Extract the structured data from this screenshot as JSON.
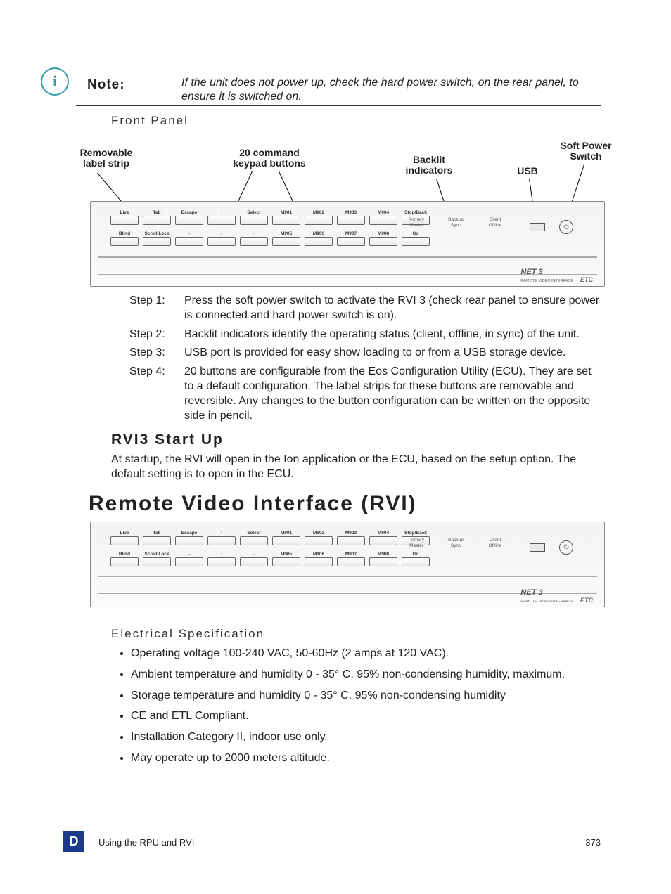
{
  "note": {
    "label": "Note:",
    "text": "If the unit does not power up, check the hard power switch, on the rear panel, to ensure it is switched on."
  },
  "frontPanelHeading": "Front Panel",
  "callouts": {
    "removable": "Removable\nlabel strip",
    "twenty": "20 command\nkeypad buttons",
    "backlit": "Backlit\nindicators",
    "usb": "USB",
    "softPower": "Soft Power\nSwitch"
  },
  "steps": [
    {
      "label": "Step 1:",
      "text": "Press the soft power switch to activate the RVI 3 (check rear panel to ensure power is connected and hard power switch is on)."
    },
    {
      "label": "Step 2:",
      "text": "Backlit indicators identify the operating status (client, offline, in sync) of the unit."
    },
    {
      "label": "Step 3:",
      "text": "USB port is provided for easy show loading to or from a USB storage device."
    },
    {
      "label": "Step 4:",
      "text": "20 buttons are configurable from the Eos Configuration Utility (ECU). They are set to a default configuration. The label strips for these buttons are removable and reversible. Any changes to the button configuration can be written on the opposite side in pencil."
    }
  ],
  "rvi3": {
    "heading": "RVI3 Start Up",
    "body": "At startup, the RVI will open in the Ion application or the ECU, based on the setup option. The default setting is to open in the ECU."
  },
  "h1": "Remote Video Interface (RVI)",
  "elecHeading": "Electrical Specification",
  "elec": [
    "Operating voltage 100-240 VAC, 50-60Hz (2 amps at 120 VAC).",
    "Ambient temperature and humidity 0 - 35° C, 95% non-condensing humidity, maximum.",
    "Storage temperature and humidity 0 - 35° C, 95% non-condensing humidity",
    "CE and ETL Compliant.",
    "Installation Category II, indoor use only.",
    "May operate up to 2000 meters altitude."
  ],
  "keypad": {
    "row1": [
      "Live",
      "Tab",
      "Escape",
      "↑",
      "Select",
      "M901",
      "M902",
      "M903",
      "M904",
      "Stop/Back"
    ],
    "row2": [
      "Blind",
      "Scroll Lock",
      "←",
      "↓",
      "→",
      "M905",
      "M906",
      "M907",
      "M908",
      "Go"
    ]
  },
  "indicators": [
    {
      "top": "Primary",
      "bottom": "Master"
    },
    {
      "top": "Backup",
      "bottom": "Sync"
    },
    {
      "top": "Client",
      "bottom": "Offline"
    }
  ],
  "brand": {
    "main": "NET 3",
    "sub": "REMOTE VIDEO INTERFACE",
    "etc": "ETC"
  },
  "footer": {
    "badge": "D",
    "section": "Using the RPU and RVI",
    "page": "373"
  }
}
